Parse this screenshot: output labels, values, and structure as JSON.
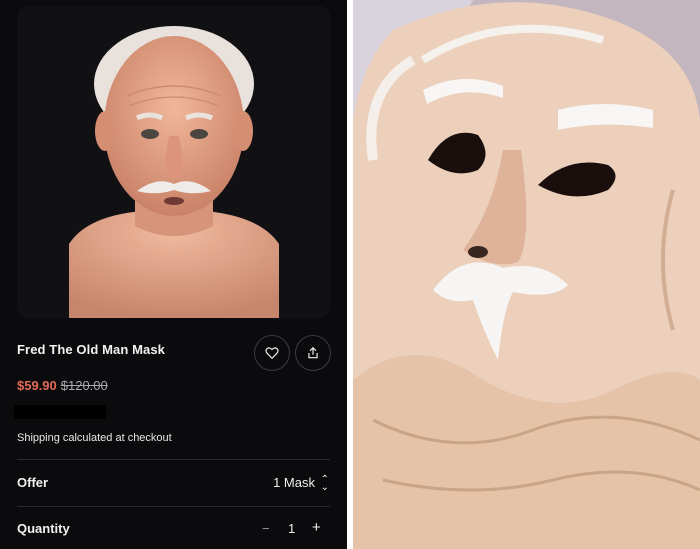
{
  "product": {
    "title": "Fred The Old Man Mask",
    "sale_price": "$59.90",
    "original_price": "$120.00",
    "shipping_note": "Shipping calculated at checkout"
  },
  "actions": {
    "favorite_icon": "heart-icon",
    "share_icon": "share-icon"
  },
  "offer": {
    "label": "Offer",
    "value": "1 Mask"
  },
  "quantity": {
    "label": "Quantity",
    "minus": "−",
    "value": "1",
    "plus": "+"
  },
  "colors": {
    "background": "#0b0b0d",
    "sale_price": "#e26a55",
    "text": "#f0f0f0"
  }
}
